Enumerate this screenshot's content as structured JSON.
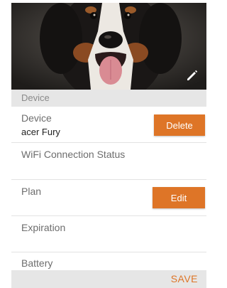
{
  "photo": {
    "alt_subject": "dog-photo",
    "edit_icon": "pencil-icon"
  },
  "section": {
    "header": "Device"
  },
  "device": {
    "label": "Device",
    "value": "acer Fury",
    "delete_label": "Delete"
  },
  "wifi": {
    "label": "WiFi Connection Status"
  },
  "plan": {
    "label": "Plan",
    "edit_label": "Edit"
  },
  "expiration": {
    "label": "Expiration"
  },
  "battery": {
    "label": "Battery"
  },
  "footer": {
    "save_label": "SAVE"
  },
  "colors": {
    "accent": "#de7527",
    "header_bg": "#e6e6e6"
  }
}
